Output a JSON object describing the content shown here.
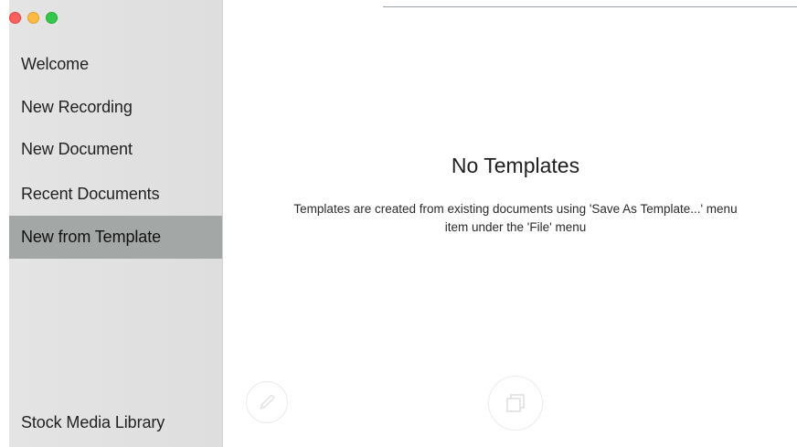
{
  "window": {
    "controls": [
      "close",
      "minimize",
      "zoom"
    ],
    "colors": {
      "close": "#fc605c",
      "minimize": "#fdbc40",
      "zoom": "#34c84a"
    }
  },
  "sidebar": {
    "items": [
      {
        "label": "Welcome",
        "selected": false
      },
      {
        "label": "New Recording",
        "selected": false
      },
      {
        "label": "New Document",
        "selected": false
      },
      {
        "label": "Recent Documents",
        "selected": false
      },
      {
        "label": "New from Template",
        "selected": true
      }
    ],
    "footer_item": {
      "label": "Stock Media Library"
    },
    "selected_color": "#a3a7a6"
  },
  "main": {
    "empty_title": "No Templates",
    "empty_desc_line1": "Templates are created from existing documents using 'Save As Template...' menu",
    "empty_desc_line2": "item under the 'File' menu",
    "buttons": {
      "edit_icon": "pencil-icon",
      "duplicate_icon": "duplicate-icon"
    }
  }
}
